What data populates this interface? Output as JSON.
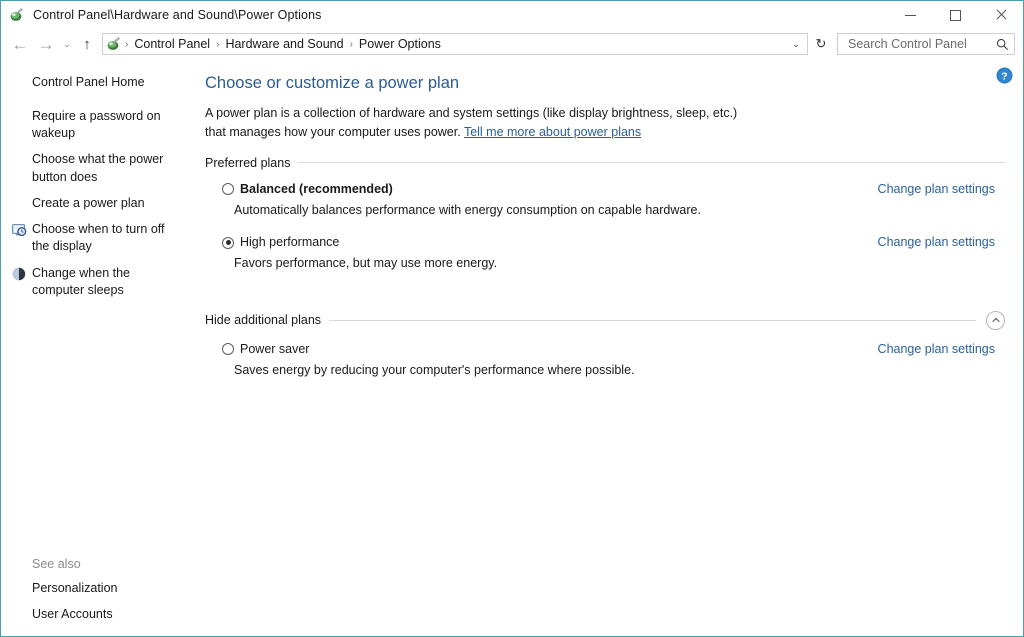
{
  "window": {
    "title": "Control Panel\\Hardware and Sound\\Power Options",
    "title_icon": "control-panel-icon",
    "controls": {
      "minimize_label": "Minimize",
      "maximize_label": "Maximize",
      "close_label": "Close"
    }
  },
  "navbar": {
    "back_label": "←",
    "forward_label": "→",
    "recent_label": "⌄",
    "up_label": "↑",
    "address_icon": "control-panel-icon",
    "breadcrumbs": [
      {
        "label": "Control Panel"
      },
      {
        "label": "Hardware and Sound"
      },
      {
        "label": "Power Options"
      }
    ],
    "separator": "›",
    "dropdown_label": "⌄",
    "refresh_label": "↻",
    "search": {
      "placeholder": "Search Control Panel",
      "value": "",
      "icon": "search-icon"
    }
  },
  "sidebar": {
    "home_label": "Control Panel Home",
    "items": [
      {
        "label": "Require a password on wakeup",
        "icon": null
      },
      {
        "label": "Choose what the power button does",
        "icon": null
      },
      {
        "label": "Create a power plan",
        "icon": null
      },
      {
        "label": "Choose when to turn off the display",
        "icon": "display-clock-icon"
      },
      {
        "label": "Change when the computer sleeps",
        "icon": "sleep-moon-icon"
      }
    ],
    "see_also": {
      "title": "See also",
      "links": [
        {
          "label": "Personalization"
        },
        {
          "label": "User Accounts"
        }
      ]
    }
  },
  "main": {
    "help_icon": "help-question-icon",
    "title": "Choose or customize a power plan",
    "description_part1": "A power plan is a collection of hardware and system settings (like display brightness, sleep, etc.) that manages how your computer uses power. ",
    "description_link": "Tell me more about power plans",
    "preferred_section": {
      "label": "Preferred plans",
      "plans": [
        {
          "name": "Balanced (recommended)",
          "bold": true,
          "selected": false,
          "description": "Automatically balances performance with energy consumption on capable hardware.",
          "action_label": "Change plan settings"
        },
        {
          "name": "High performance",
          "bold": false,
          "selected": true,
          "description": "Favors performance, but may use more energy.",
          "action_label": "Change plan settings"
        }
      ]
    },
    "additional_section": {
      "label": "Hide additional plans",
      "collapse_icon": "chevron-up-icon",
      "plans": [
        {
          "name": "Power saver",
          "bold": false,
          "selected": false,
          "description": "Saves energy by reducing your computer's performance where possible.",
          "action_label": "Change plan settings"
        }
      ]
    }
  },
  "colors": {
    "link_blue": "#2a6099",
    "title_blue": "#2b5c94",
    "window_border": "#4e9cb0",
    "help_blue": "#2b7cc4"
  }
}
